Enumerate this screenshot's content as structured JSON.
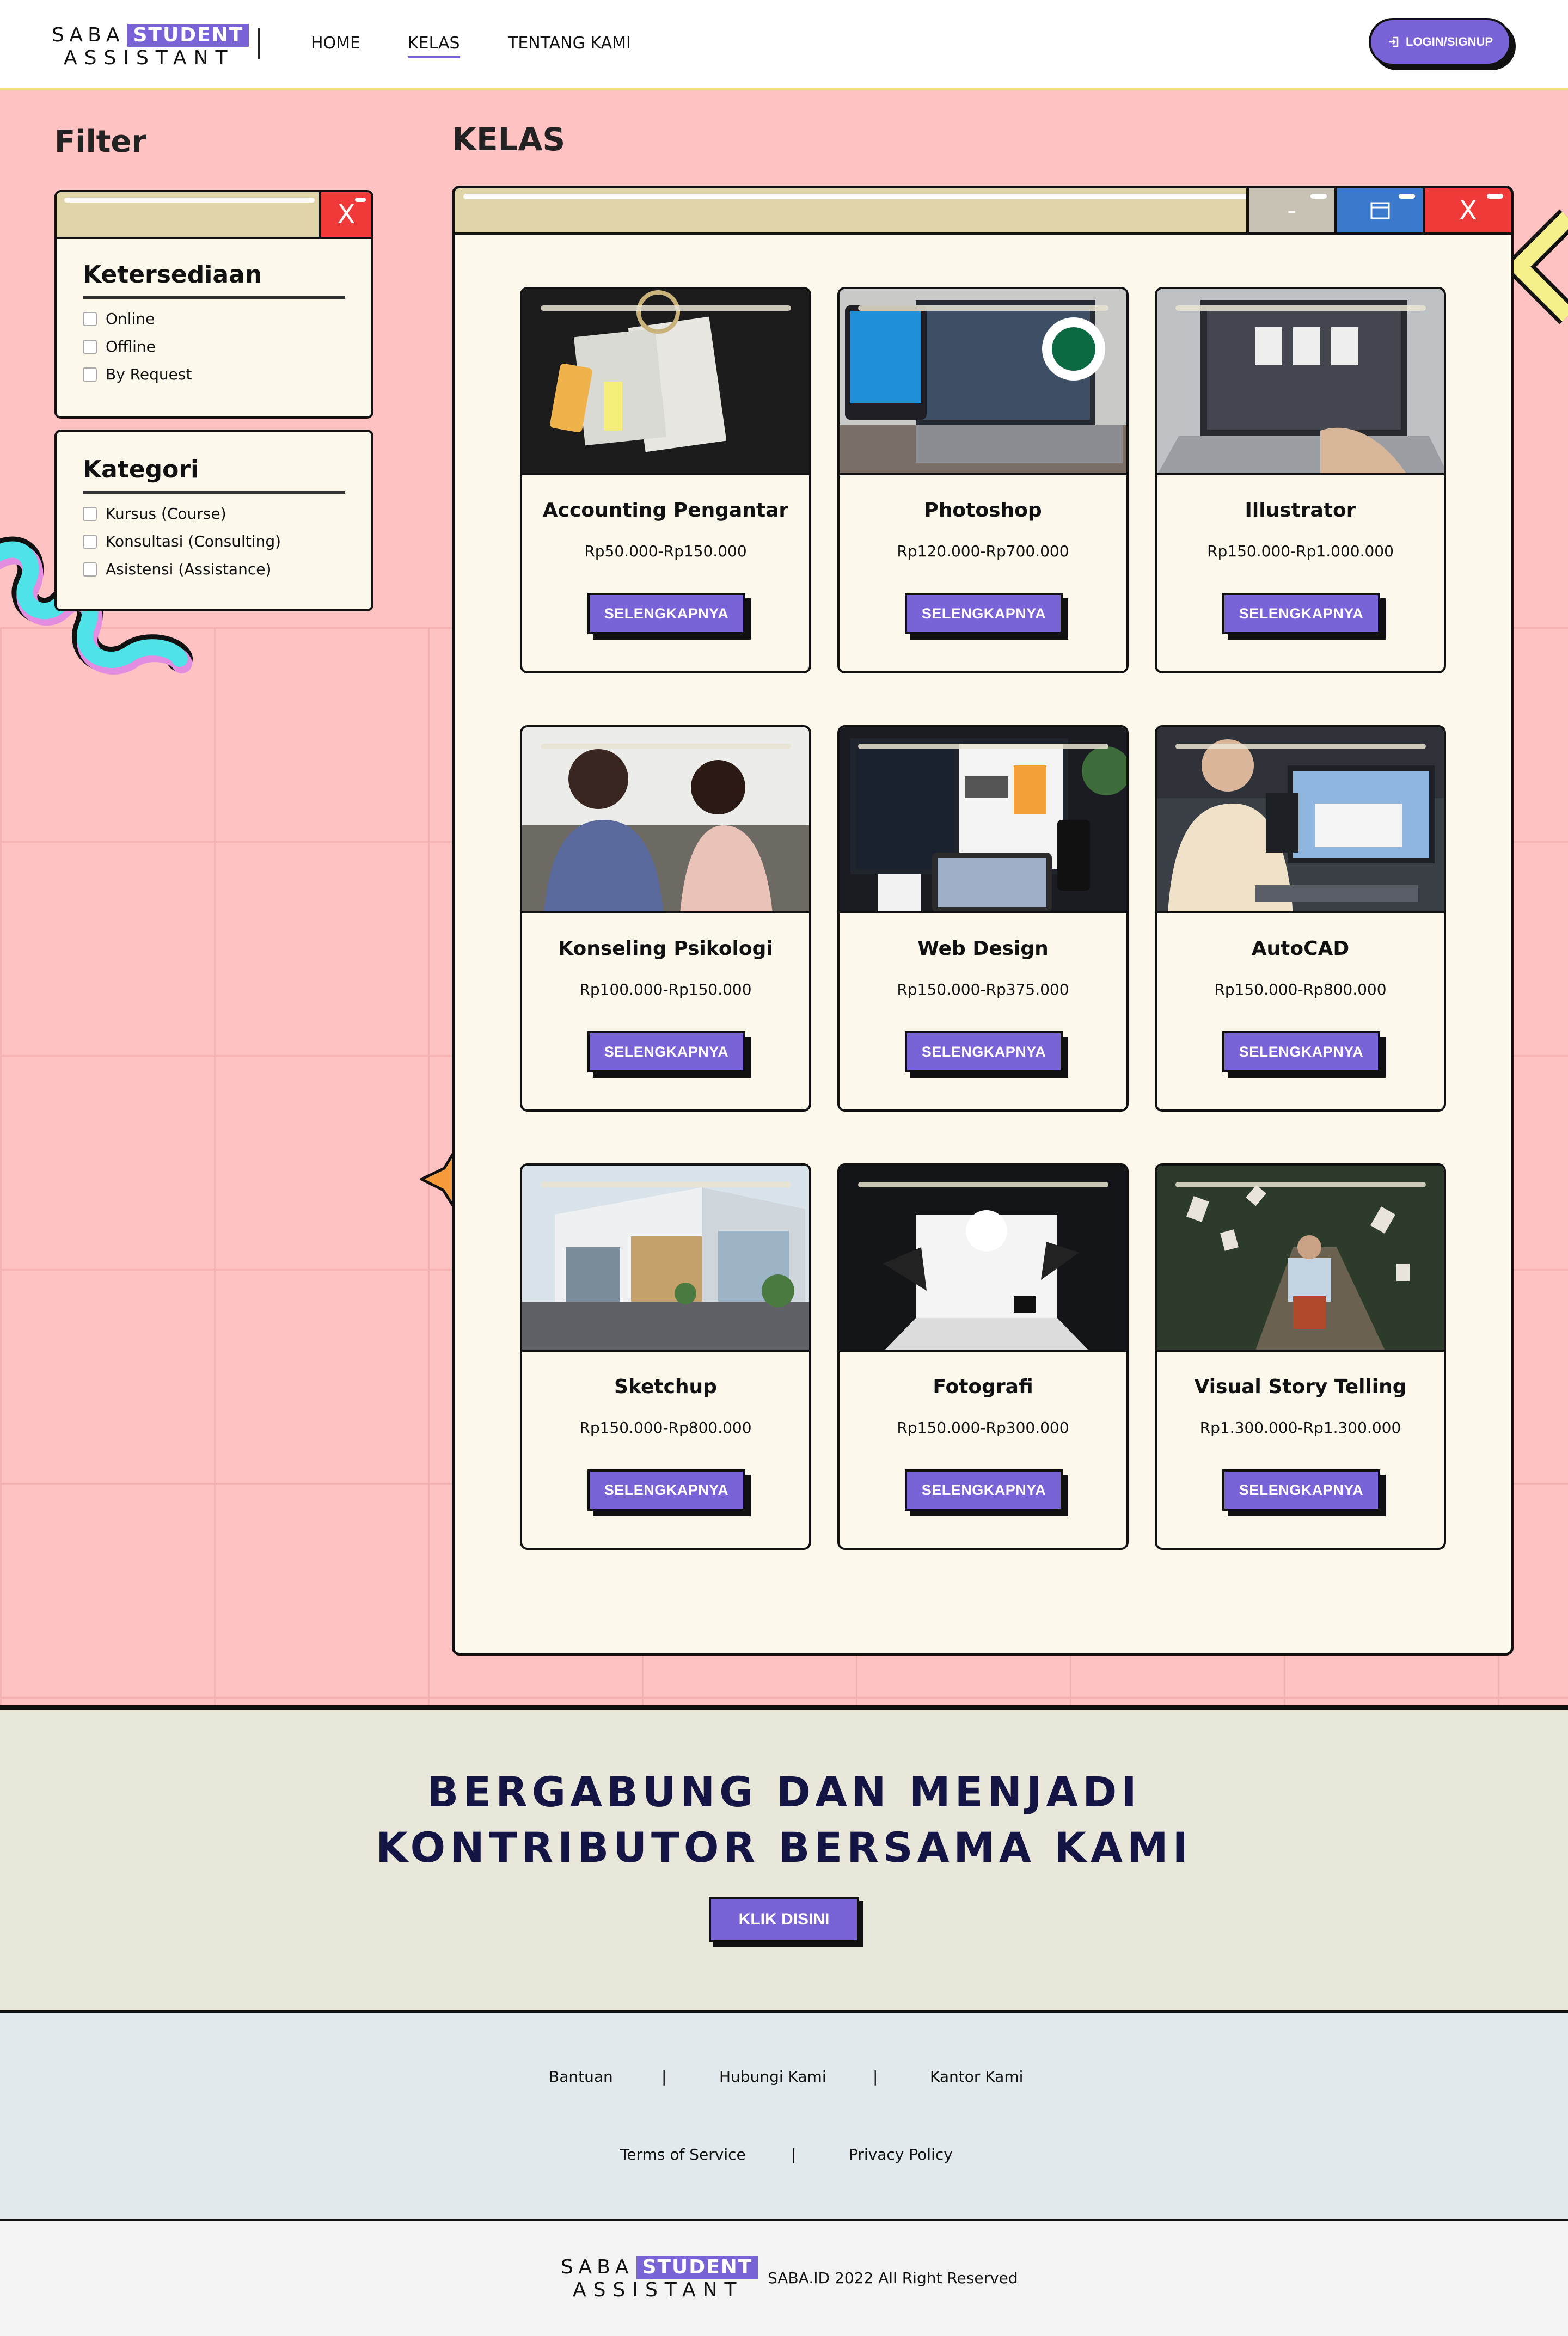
{
  "brand": {
    "saba": "SABA",
    "student": "STUDENT",
    "assistant": "ASSISTANT"
  },
  "nav": {
    "links": [
      {
        "label": "HOME",
        "active": false
      },
      {
        "label": "KELAS",
        "active": true
      },
      {
        "label": "TENTANG KAMI",
        "active": false
      }
    ],
    "login_label": "LOGIN/SIGNUP"
  },
  "filter": {
    "title": "Filter",
    "close_label": "X",
    "availability": {
      "title": "Ketersediaan",
      "options": [
        "Online",
        "Offline",
        "By Request"
      ]
    },
    "category": {
      "title": "Kategori",
      "options": [
        "Kursus (Course)",
        "Konsultasi (Consulting)",
        "Asistensi (Assistance)"
      ]
    }
  },
  "kelas": {
    "title": "KELAS",
    "window_buttons": {
      "minimize": "-",
      "close": "X"
    },
    "button_label": "SELENGKAPNYA",
    "cards": [
      {
        "title": "Accounting Pengantar",
        "price": "Rp50.000-Rp150.000"
      },
      {
        "title": "Photoshop",
        "price": "Rp120.000-Rp700.000"
      },
      {
        "title": "Illustrator",
        "price": "Rp150.000-Rp1.000.000"
      },
      {
        "title": "Konseling Psikologi",
        "price": "Rp100.000-Rp150.000"
      },
      {
        "title": "Web Design",
        "price": "Rp150.000-Rp375.000"
      },
      {
        "title": "AutoCAD",
        "price": "Rp150.000-Rp800.000"
      },
      {
        "title": "Sketchup",
        "price": "Rp150.000-Rp800.000"
      },
      {
        "title": "Fotografi",
        "price": "Rp150.000-Rp300.000"
      },
      {
        "title": "Visual Story Telling",
        "price": "Rp1.300.000-Rp1.300.000"
      }
    ]
  },
  "cta": {
    "line1": "BERGABUNG DAN MENJADI",
    "line2": "KONTRIBUTOR BERSAMA KAMI",
    "button": "KLIK DISINI"
  },
  "footer": {
    "links_row1": [
      "Bantuan",
      "Hubungi Kami",
      "Kantor Kami"
    ],
    "links_row2": [
      "Terms of Service",
      "Privacy Policy"
    ],
    "separator": "|",
    "copyright": "SABA.ID 2022 All Right Reserved"
  },
  "colors": {
    "accent": "#7a63d6",
    "background": "#ffc2c2",
    "window_bar": "#e0d5a8",
    "close_red": "#f03a3a",
    "maximize_blue": "#3a79cc",
    "cta_text": "#151545"
  }
}
